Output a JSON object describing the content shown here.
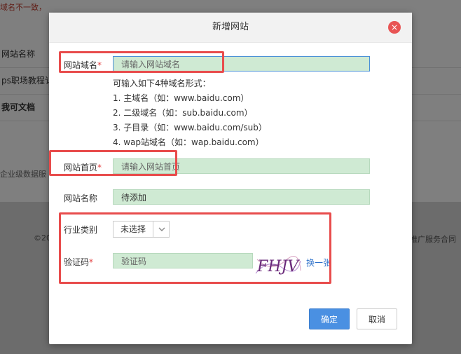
{
  "background": {
    "warning": "域名不一致，",
    "rows": [
      "网站名称",
      "ps职场教程讠",
      "我可文档"
    ],
    "enterprise": "企业级数据服",
    "copyright": "©20",
    "footer_link": "推广服务合同"
  },
  "modal": {
    "title": "新增网站",
    "close_label": "×",
    "domain": {
      "label": "网站域名",
      "required": "*",
      "placeholder": "请输入网站域名"
    },
    "domain_hint": {
      "title": "可输入如下4种域名形式：",
      "items": [
        "1. 主域名（如：www.baidu.com）",
        "2. 二级域名（如：sub.baidu.com）",
        "3. 子目录（如：www.baidu.com/sub）",
        "4. wap站域名（如：wap.baidu.com）"
      ]
    },
    "homepage": {
      "label": "网站首页",
      "required": "*",
      "placeholder": "请输入网站首页"
    },
    "site_name": {
      "label": "网站名称",
      "value": "待添加"
    },
    "industry": {
      "label": "行业类别",
      "selected": "未选择"
    },
    "captcha": {
      "label": "验证码",
      "required": "*",
      "placeholder": "验证码",
      "image_text": "FHJV",
      "refresh": "换一张"
    },
    "buttons": {
      "ok": "确定",
      "cancel": "取消"
    }
  },
  "colors": {
    "accent": "#4a90e2",
    "highlight_box": "#e84c4c",
    "field_bg": "#cfead3",
    "close": "#e85454"
  }
}
